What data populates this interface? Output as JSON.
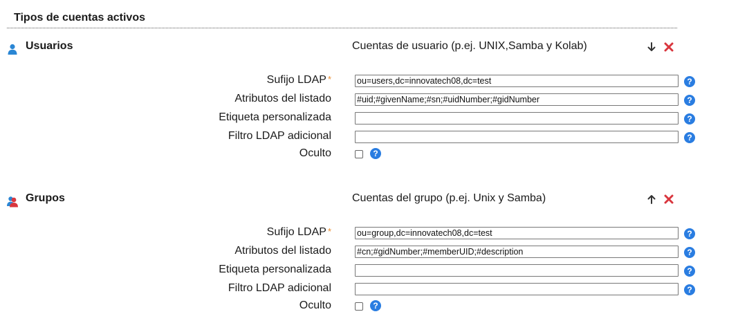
{
  "section": {
    "title": "Tipos de cuentas activos"
  },
  "colors": {
    "help": "#2a7de1",
    "delete": "#d9363e",
    "required": "#e8892b",
    "user_icon": "#2a86d4",
    "group_icon": "#d9363e"
  },
  "account_types": [
    {
      "name": "Usuarios",
      "icon": "user-icon",
      "description": "Cuentas de usuario (p.ej. UNIX,Samba y Kolab)",
      "move_action": "arrow-down-icon",
      "fields": {
        "suffix": {
          "label": "Sufijo LDAP",
          "required_mark": "*",
          "value": "ou=users,dc=innovatech08,dc=test"
        },
        "list_attributes": {
          "label": "Atributos del listado",
          "value": "#uid;#givenName;#sn;#uidNumber;#gidNumber"
        },
        "custom_label": {
          "label": "Etiqueta personalizada",
          "value": ""
        },
        "additional_filter": {
          "label": "Filtro LDAP adicional",
          "value": ""
        },
        "hidden": {
          "label": "Oculto",
          "checked": false
        }
      }
    },
    {
      "name": "Grupos",
      "icon": "group-icon",
      "description": "Cuentas del grupo (p.ej. Unix y Samba)",
      "move_action": "arrow-up-icon",
      "fields": {
        "suffix": {
          "label": "Sufijo LDAP",
          "required_mark": "*",
          "value": "ou=group,dc=innovatech08,dc=test"
        },
        "list_attributes": {
          "label": "Atributos del listado",
          "value": "#cn;#gidNumber;#memberUID;#description"
        },
        "custom_label": {
          "label": "Etiqueta personalizada",
          "value": ""
        },
        "additional_filter": {
          "label": "Filtro LDAP adicional",
          "value": ""
        },
        "hidden": {
          "label": "Oculto",
          "checked": false
        }
      }
    }
  ],
  "help_glyph": "?"
}
